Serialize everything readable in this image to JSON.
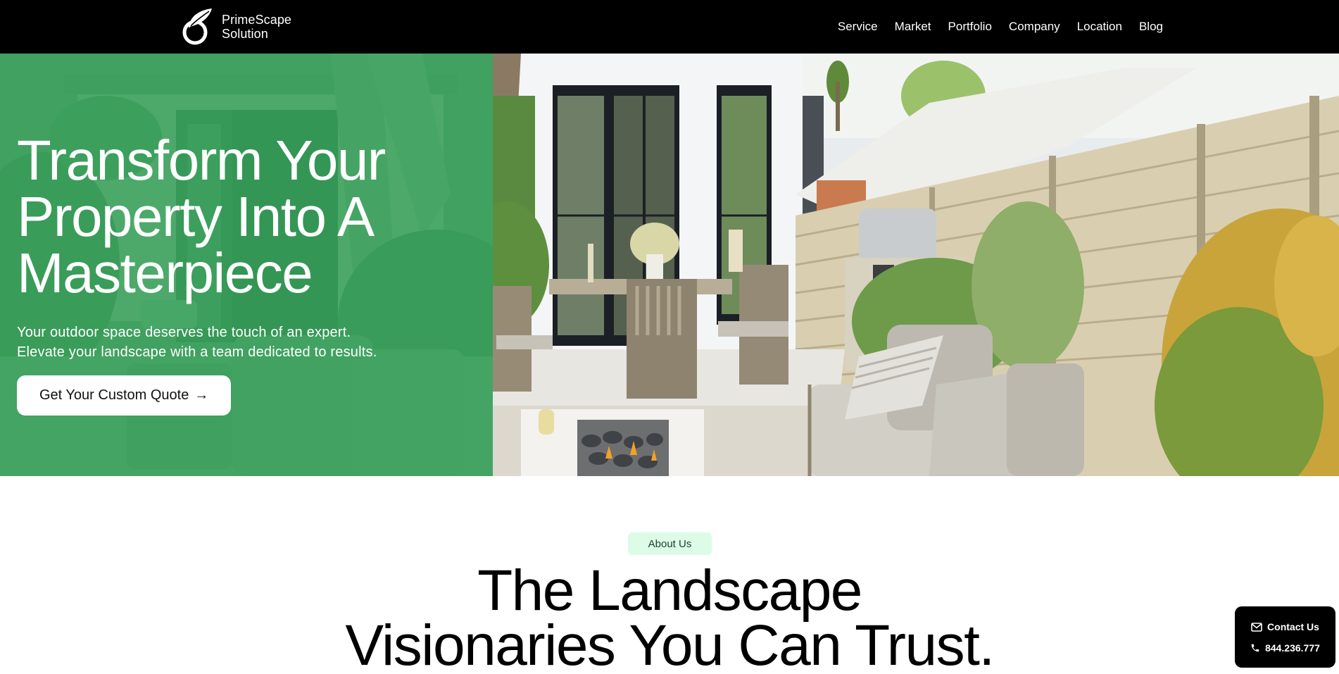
{
  "brand": {
    "name_line1": "PrimeScape",
    "name_line2": "Solution",
    "logo_icon": "leaf-ring-icon"
  },
  "nav": {
    "items": [
      {
        "label": "Service"
      },
      {
        "label": "Market"
      },
      {
        "label": "Portfolio"
      },
      {
        "label": "Company"
      },
      {
        "label": "Location"
      },
      {
        "label": "Blog"
      }
    ]
  },
  "hero": {
    "title_line1": "Transform Your",
    "title_line2": "Property Into A",
    "title_line3": "Masterpiece",
    "subtitle_line1": "Your outdoor space deserves the touch of an expert.",
    "subtitle_line2": "Elevate your landscape with a team dedicated to results.",
    "cta_label": "Get Your Custom Quote",
    "cta_icon": "arrow-right-icon",
    "cta_arrow": "→",
    "overlay_color": "#38a05c",
    "left_image_alt": "Backyard patio with chairs under green overlay",
    "right_image_alt": "Outdoor patio with dining set, grill, wooden fence and fire pit"
  },
  "about": {
    "badge": "About Us",
    "title_line1": "The Landscape",
    "title_line2": "Visionaries You Can Trust.",
    "badge_color": "#dcfce7"
  },
  "contact_widget": {
    "contact_label": "Contact Us",
    "contact_icon": "mail-icon",
    "phone": "844.236.777",
    "phone_icon": "phone-icon"
  }
}
